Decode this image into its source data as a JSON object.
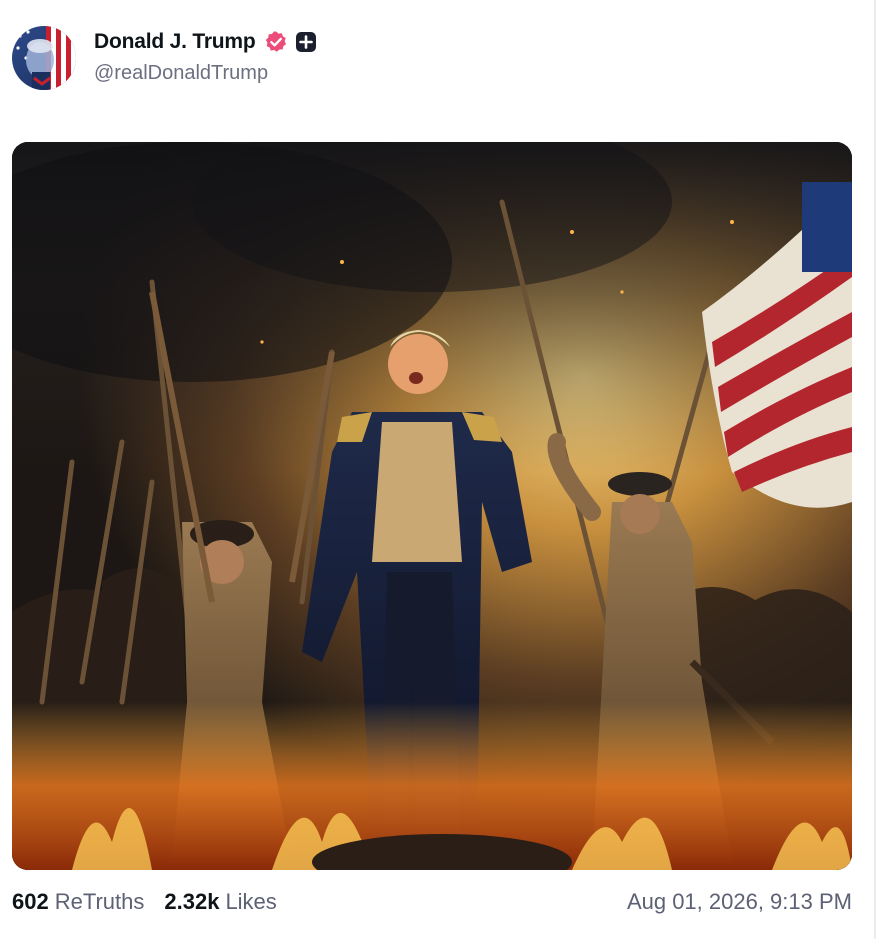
{
  "author": {
    "display_name": "Donald J. Trump",
    "handle": "@realDonaldTrump",
    "verified_badge_icon": "verified-check-icon",
    "verified_badge_color": "#ec4c7a",
    "plus_badge_icon": "plus-square-icon"
  },
  "post": {
    "image_alt": "Painted scene of colonial soldiers with muskets and an American flag amid fire and smoke",
    "stats": {
      "retruths_count": "602",
      "retruths_label": "ReTruths",
      "likes_count": "2.32k",
      "likes_label": "Likes"
    },
    "timestamp": "Aug 01, 2026, 9:13 PM"
  },
  "colors": {
    "text_primary": "#0f1419",
    "text_secondary": "#5d6174"
  }
}
